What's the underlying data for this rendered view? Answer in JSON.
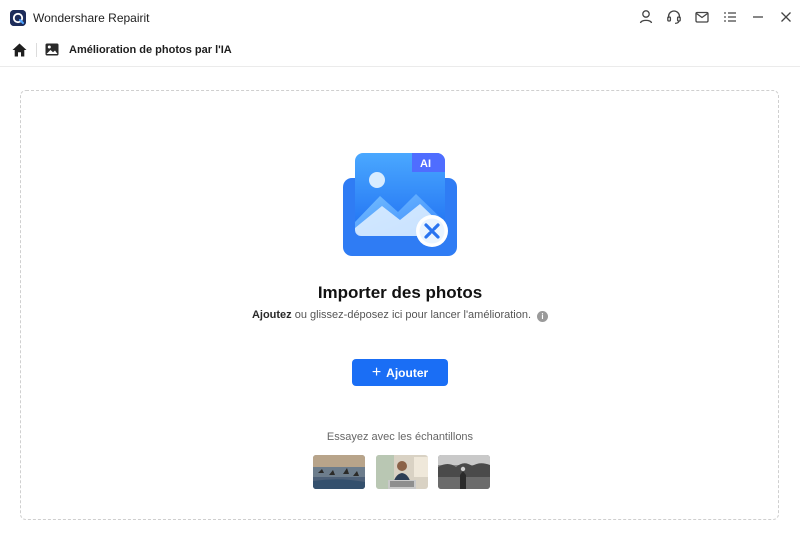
{
  "app": {
    "title": "Wondershare Repairit",
    "logo_icon": "repairit-logo-icon"
  },
  "titlebar": {
    "icons": [
      "user-icon",
      "headset-icon",
      "mail-icon",
      "menu-icon",
      "minimize-icon",
      "close-icon"
    ]
  },
  "breadcrumb": {
    "home_icon": "home-icon",
    "page_icon": "photo-icon",
    "page_title": "Amélioration de photos par l'IA"
  },
  "main": {
    "import_title": "Importer des photos",
    "desc_strong": "Ajoutez",
    "desc_rest": " ou glissez-déposez ici pour lancer l'amélioration.",
    "illustration_badge": "AI",
    "add_button": "Ajouter",
    "samples_label": "Essayez avec les échantillons",
    "samples": [
      "sample-birds-landscape",
      "sample-man-laptop",
      "sample-black-white-scene"
    ]
  },
  "colors": {
    "accent": "#1a6ef5",
    "logo": "#1d2c5a",
    "dropzone_border": "#cfcfcf"
  }
}
